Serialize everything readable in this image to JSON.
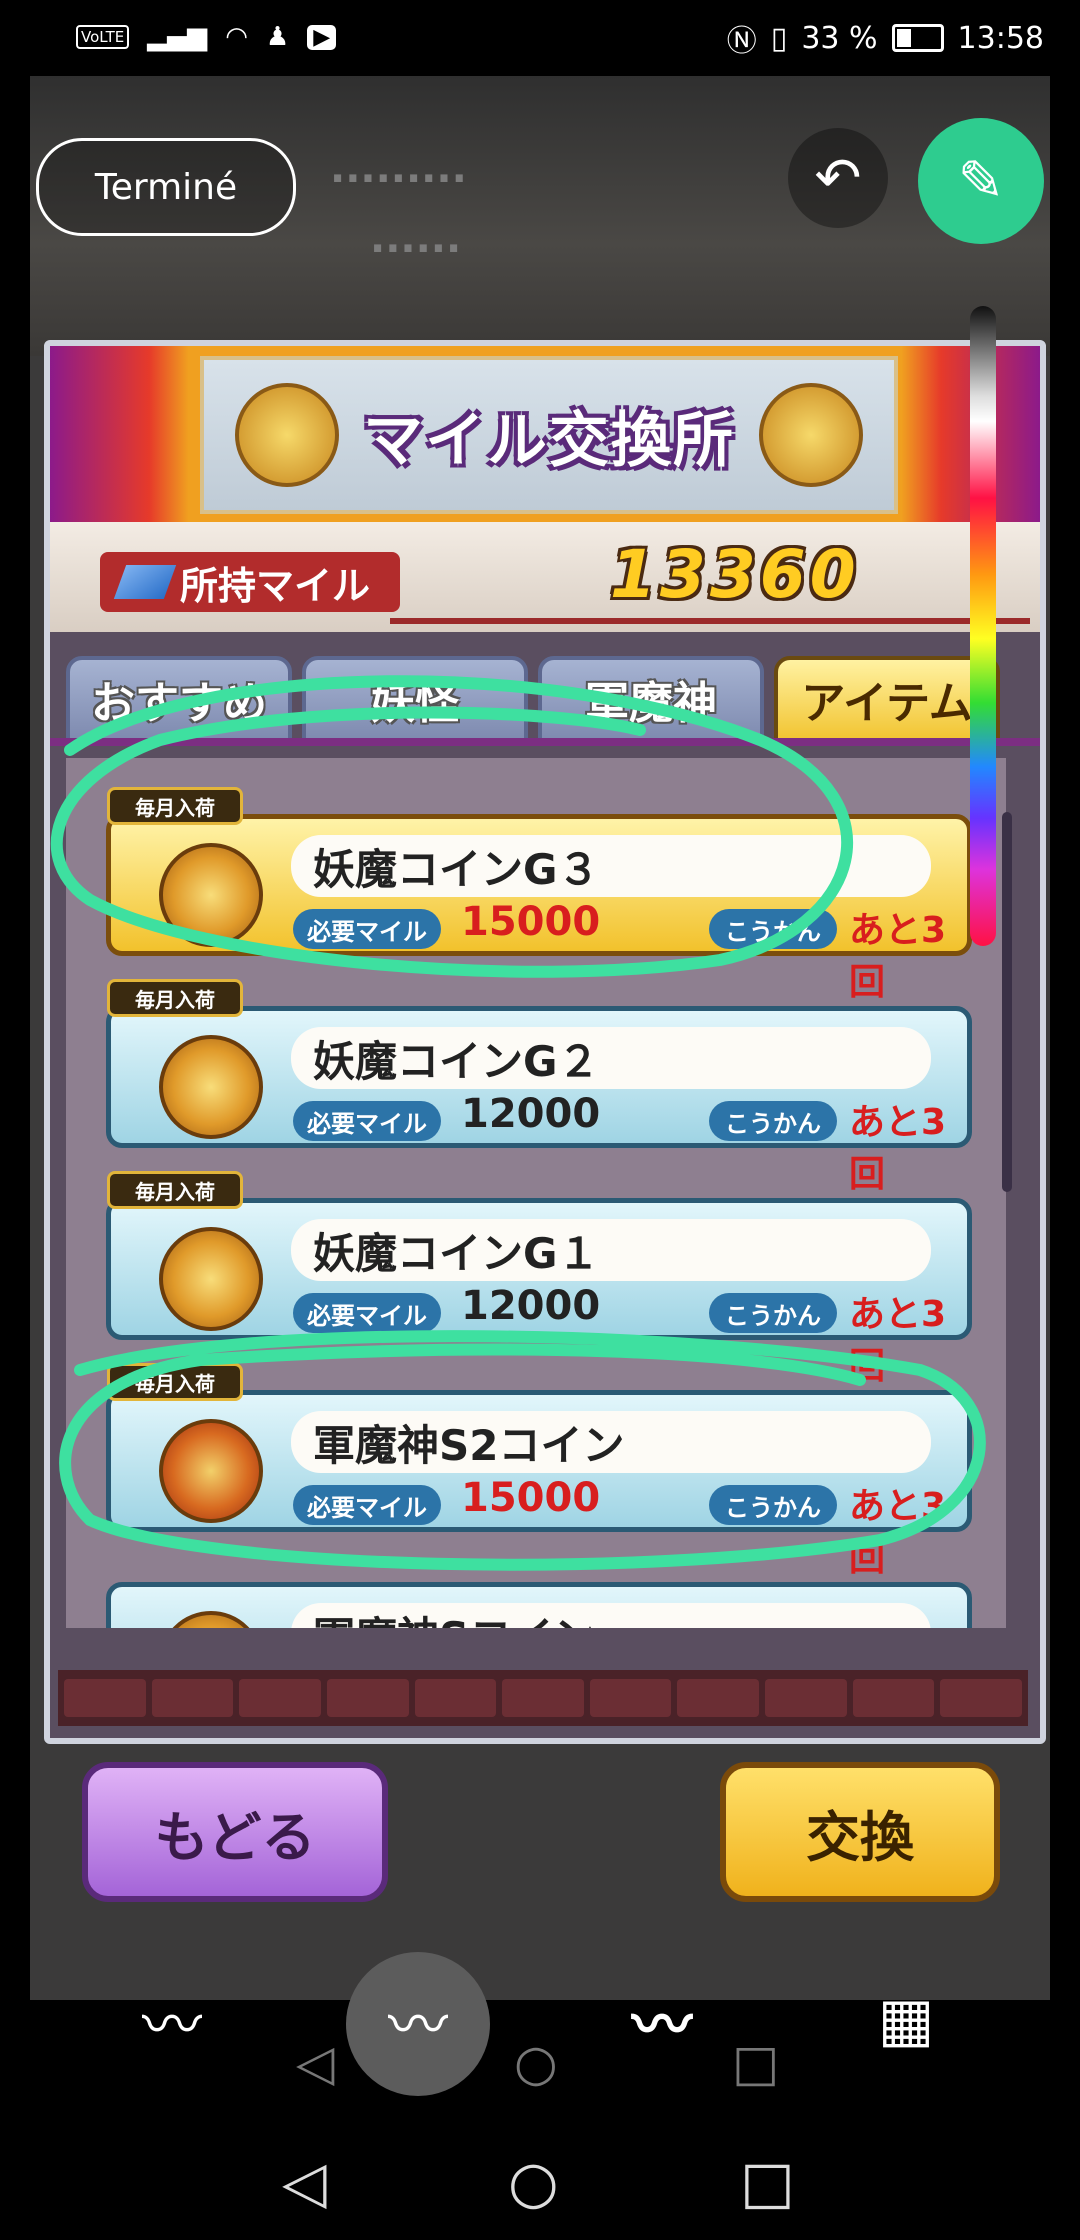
{
  "status_bar": {
    "volte": "VoLTE",
    "battery": "33 %",
    "time": "13:58"
  },
  "editor": {
    "done_label": "Terminé",
    "undo_icon": "undo-icon",
    "pen_icon": "pen-icon",
    "brushes": [
      "thin-brush-icon",
      "marker-brush-icon",
      "thick-brush-icon",
      "eraser-brush-icon"
    ],
    "selected_brush_index": 1
  },
  "game": {
    "banner_title": "マイル交換所",
    "mile_label": "所持マイル",
    "mile_value": "13360",
    "tabs": [
      {
        "label": "おすすめ",
        "active": false
      },
      {
        "label": "妖怪",
        "active": false
      },
      {
        "label": "軍魔神",
        "active": false
      },
      {
        "label": "アイテム",
        "active": true
      }
    ],
    "items": [
      {
        "badge": "毎月入荷",
        "name": "妖魔コインG３",
        "cost_label": "必要マイル",
        "cost": "15000",
        "cost_insufficient": true,
        "swap_label": "こうかん",
        "remaining": "あと3回",
        "highlighted": true
      },
      {
        "badge": "毎月入荷",
        "name": "妖魔コインG２",
        "cost_label": "必要マイル",
        "cost": "12000",
        "cost_insufficient": false,
        "swap_label": "こうかん",
        "remaining": "あと3回",
        "highlighted": false
      },
      {
        "badge": "毎月入荷",
        "name": "妖魔コインG１",
        "cost_label": "必要マイル",
        "cost": "12000",
        "cost_insufficient": false,
        "swap_label": "こうかん",
        "remaining": "あと3回",
        "highlighted": false
      },
      {
        "badge": "毎月入荷",
        "name": "軍魔神S2コイン",
        "cost_label": "必要マイル",
        "cost": "15000",
        "cost_insufficient": true,
        "swap_label": "こうかん",
        "remaining": "あと3回",
        "highlighted": false
      },
      {
        "badge": "",
        "name": "軍魔神Sコイン",
        "cost_label": "",
        "cost": "",
        "cost_insufficient": false,
        "swap_label": "",
        "remaining": "",
        "highlighted": false
      }
    ],
    "back_label": "もどる",
    "exchange_label": "交換"
  },
  "colors": {
    "annotation": "#3ee0a0",
    "pen_button": "#2ecc8f",
    "insufficient": "#d81e1e"
  }
}
